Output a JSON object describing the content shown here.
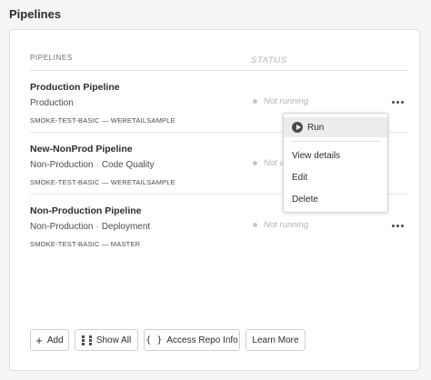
{
  "page": {
    "title": "Pipelines"
  },
  "table": {
    "columns": {
      "name": "PIPELINES",
      "status": "STATUS"
    },
    "rows": [
      {
        "name": "Production Pipeline",
        "type_primary": "Production",
        "type_secondary": "",
        "meta": "SMOKE-TEST-BASIC — WERETAILSAMPLE",
        "status": "Not running"
      },
      {
        "name": "New-NonProd Pipeline",
        "type_primary": "Non-Production",
        "type_secondary": "Code Quality",
        "meta": "SMOKE-TEST-BASIC — WERETAILSAMPLE",
        "status": "Not a"
      },
      {
        "name": "Non-Production Pipeline",
        "type_primary": "Non-Production",
        "type_secondary": "Deployment",
        "meta": "SMOKE-TEST-BASIC — MASTER",
        "status": "Not running"
      }
    ]
  },
  "menu": {
    "run": "Run",
    "view_details": "View details",
    "edit": "Edit",
    "delete": "Delete"
  },
  "toolbar": {
    "add": "Add",
    "show_all": "Show All",
    "access_repo_info": "Access Repo Info",
    "learn_more": "Learn More"
  },
  "icons": {
    "run": "play-circle-icon",
    "add": "plus-icon",
    "show_all": "grid-icon",
    "access_repo_info": "braces-icon",
    "more": "more-dots-icon"
  },
  "colors": {
    "status_dot": "#c7c7c7",
    "menu_highlight": "#ececec"
  }
}
